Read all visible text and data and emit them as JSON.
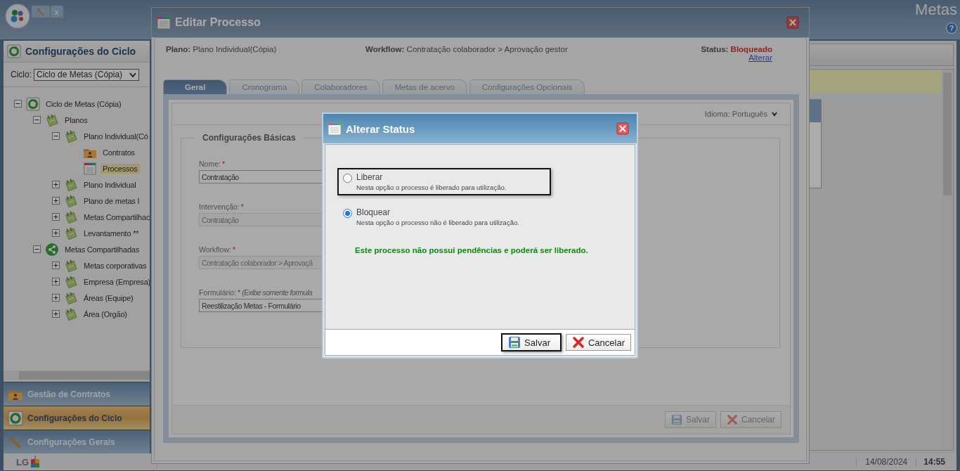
{
  "app": {
    "title": "Metas",
    "close_tab": "x",
    "help": "?"
  },
  "sidebar": {
    "title": "Configurações do Ciclo",
    "cycle_label": "Ciclo:",
    "cycle_value": "Ciclo de Metas (Cópia)",
    "tree": [
      {
        "label": "Ciclo de Metas (Cópia)",
        "kind": "cycle",
        "expanded": true,
        "selected": false,
        "children": [
          {
            "label": "Planos",
            "kind": "plan",
            "expanded": true,
            "selected": false,
            "children": [
              {
                "label": "Plano Individual(Có",
                "kind": "plan",
                "expanded": true,
                "selected": false,
                "children": [
                  {
                    "label": "Contratos",
                    "kind": "folder",
                    "selected": false
                  },
                  {
                    "label": "Processos",
                    "kind": "doc",
                    "selected": true
                  }
                ]
              },
              {
                "label": "Plano Individual",
                "kind": "plan",
                "expanded": false,
                "selected": false
              },
              {
                "label": "Plano de metas I",
                "kind": "plan",
                "expanded": false,
                "selected": false
              },
              {
                "label": "Metas Compartilhac",
                "kind": "plan",
                "expanded": false,
                "selected": false
              },
              {
                "label": "Levantamento **",
                "kind": "plan",
                "expanded": false,
                "selected": false
              }
            ]
          },
          {
            "label": "Metas Compartilhadas",
            "kind": "share",
            "expanded": true,
            "selected": false,
            "children": [
              {
                "label": "Metas corporativas",
                "kind": "plan",
                "expanded": false,
                "selected": false
              },
              {
                "label": "Empresa (Empresa)",
                "kind": "plan",
                "expanded": false,
                "selected": false
              },
              {
                "label": "Áreas (Equipe)",
                "kind": "plan",
                "expanded": false,
                "selected": false
              },
              {
                "label": "Área (Orgão)",
                "kind": "plan",
                "expanded": false,
                "selected": false
              }
            ]
          }
        ]
      }
    ],
    "accordion": [
      {
        "label": "Gestão de Contratos",
        "kind": "folder",
        "selected": false
      },
      {
        "label": "Configurações do Ciclo",
        "kind": "cycle",
        "selected": true
      },
      {
        "label": "Configurações Gerais",
        "kind": "wrench",
        "selected": false
      }
    ]
  },
  "status_bar": {
    "logo": "LG",
    "date": "14/08/2024",
    "time": "14:55"
  },
  "editor": {
    "title": "Editar Processo",
    "info": [
      {
        "label": "Plano:",
        "value": "Plano Individual(Cópia)"
      },
      {
        "label": "Workflow:",
        "value": "Contratação colaborador > Aprovação gestor"
      }
    ],
    "status": {
      "label": "Status:",
      "value": "Bloqueado",
      "link": "Alterar"
    },
    "tabs": [
      {
        "label": "Geral",
        "selected": true
      },
      {
        "label": "Cronograma",
        "selected": false
      },
      {
        "label": "Colaboradores",
        "selected": false
      },
      {
        "label": "Metas de acervo",
        "selected": false
      },
      {
        "label": "Configurações Opcionais",
        "selected": false
      }
    ],
    "language": {
      "label": "Idioma:",
      "value": "Português"
    },
    "fieldset": {
      "legend": "Configurações Básicas",
      "fields": [
        {
          "label": "Nome:",
          "mark": "*",
          "value": "Contratação",
          "disabled": false
        },
        {
          "label": "Intervenção:",
          "mark": "*",
          "value": "Contratação",
          "disabled": true
        },
        {
          "label": "Workflow:",
          "mark": "*",
          "value": "Contratação colaborador > Aprovaçã",
          "disabled": true
        },
        {
          "label": "Formulário:",
          "mark": "*",
          "hint": "(Exibe somente formula",
          "value": "Reestilização Metas - Formulário",
          "disabled": false
        }
      ]
    },
    "buttons": [
      {
        "label": "Salvar",
        "kind": "save",
        "disabled": true
      },
      {
        "label": "Cancelar",
        "kind": "cancel",
        "disabled": true
      }
    ]
  },
  "dialog": {
    "title": "Alterar Status",
    "options": [
      {
        "label": "Liberar",
        "description": "Nesta opção o processo é liberado para utilização.",
        "selected": false,
        "highlighted": true
      },
      {
        "label": "Bloquear",
        "description": "Nesta opção o processo não é liberado para utilização.",
        "selected": true,
        "highlighted": false
      }
    ],
    "message": "Este processo não possui pendências e poderá ser liberado.",
    "buttons": [
      {
        "label": "Salvar",
        "kind": "save",
        "highlighted": true
      },
      {
        "label": "Cancelar",
        "kind": "cancel",
        "highlighted": false
      }
    ]
  }
}
